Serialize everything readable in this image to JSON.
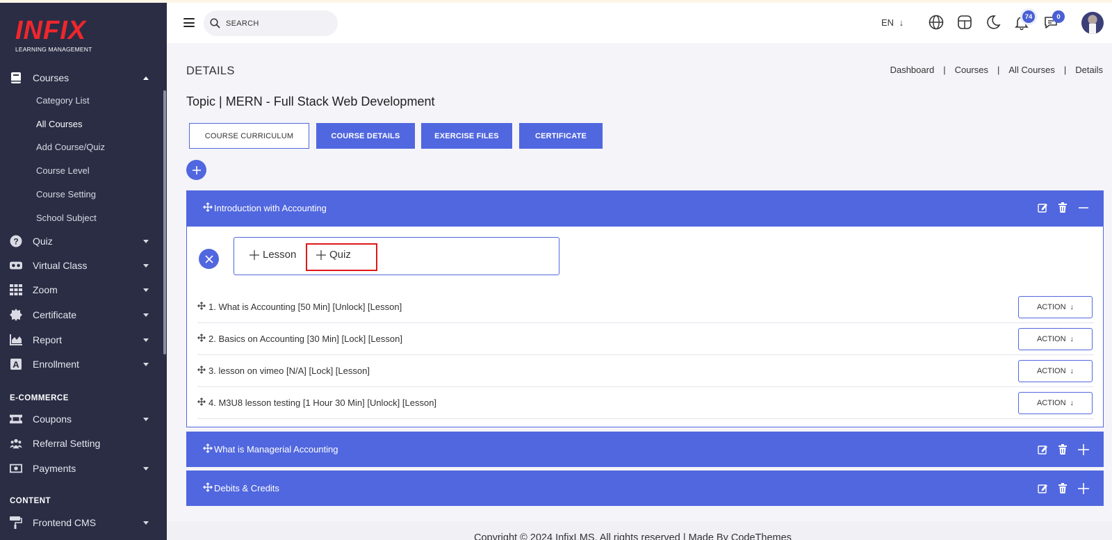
{
  "brand": {
    "name": "INFIX",
    "subtitle": "LEARNING MANAGEMENT"
  },
  "sidebar": {
    "courses_label": "Courses",
    "course_subitems": [
      "Category List",
      "All Courses",
      "Add Course/Quiz",
      "Course Level",
      "Course Setting",
      "School Subject"
    ],
    "active_subitem": "All Courses",
    "items": [
      {
        "label": "Quiz",
        "icon": "question-circle-icon"
      },
      {
        "label": "Virtual Class",
        "icon": "vr-headset-icon"
      },
      {
        "label": "Zoom",
        "icon": "grid-icon"
      },
      {
        "label": "Certificate",
        "icon": "certificate-badge-icon"
      },
      {
        "label": "Report",
        "icon": "area-chart-icon"
      },
      {
        "label": "Enrollment",
        "icon": "letter-a-icon"
      }
    ],
    "ecommerce_title": "E-COMMERCE",
    "ecommerce_items": [
      {
        "label": "Coupons",
        "icon": "ticket-icon"
      },
      {
        "label": "Referral Setting",
        "icon": "users-icon"
      },
      {
        "label": "Payments",
        "icon": "money-icon"
      }
    ],
    "content_title": "CONTENT",
    "content_items": [
      {
        "label": "Frontend CMS",
        "icon": "paint-roller-icon"
      }
    ]
  },
  "header": {
    "search_placeholder": "SEARCH",
    "language": "EN",
    "notification_count": "74",
    "message_count": "0"
  },
  "page": {
    "title": "DETAILS",
    "breadcrumb": [
      "Dashboard",
      "Courses",
      "All Courses",
      "Details"
    ],
    "topic": "Topic | MERN - Full Stack Web Development",
    "tabs": [
      "COURSE CURRICULUM",
      "COURSE DETAILS",
      "EXERCISE FILES",
      "CERTIFICATE"
    ],
    "active_tab": "COURSE CURRICULUM"
  },
  "sections": [
    {
      "title": "Introduction with Accounting",
      "expanded": true
    },
    {
      "title": "What is Managerial Accounting",
      "expanded": false
    },
    {
      "title": "Debits & Credits",
      "expanded": false
    }
  ],
  "add_options": {
    "lesson": "Lesson",
    "quiz": "Quiz"
  },
  "lessons": [
    "1. What is Accounting [50 Min] [Unlock] [Lesson]",
    "2. Basics on Accounting [30 Min] [Lock] [Lesson]",
    "3. lesson on vimeo [N/A] [Lock] [Lesson]",
    "4. M3U8 lesson testing [1 Hour 30 Min] [Unlock] [Lesson]"
  ],
  "action_label": "ACTION",
  "footer": {
    "copyright": "Copyright © 2024 InfixLMS. All rights reserved | Made By CodeThemes"
  },
  "colors": {
    "accent": "#5167df",
    "sidebar": "#2a2d44",
    "highlight": "#e01818",
    "logo": "#f0262d"
  }
}
